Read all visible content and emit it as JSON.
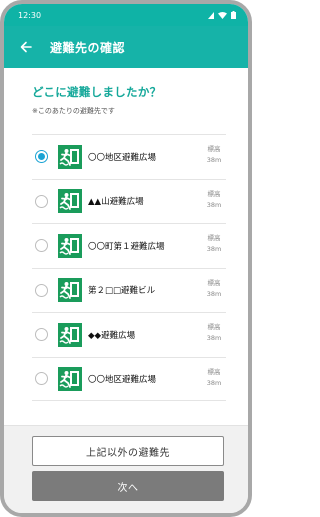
{
  "status_bar": {
    "time": "12:30"
  },
  "header": {
    "title": "避難先の確認"
  },
  "question": "どこに避難しましたか？",
  "note": "※このあたりの避難先です",
  "list": [
    {
      "name": "〇〇地区避難広場",
      "alt_label": "標高",
      "alt_value": "38m",
      "selected": true
    },
    {
      "name": "▲▲山避難広場",
      "alt_label": "標高",
      "alt_value": "38m",
      "selected": false
    },
    {
      "name": "〇〇町第１避難広場",
      "alt_label": "標高",
      "alt_value": "38m",
      "selected": false
    },
    {
      "name": "第２□□避難ビル",
      "alt_label": "標高",
      "alt_value": "38m",
      "selected": false
    },
    {
      "name": "◆◆避難広場",
      "alt_label": "標高",
      "alt_value": "38m",
      "selected": false
    },
    {
      "name": "〇〇地区避難広場",
      "alt_label": "標高",
      "alt_value": "38m",
      "selected": false
    }
  ],
  "buttons": {
    "other": "上記以外の避難先",
    "next": "次へ"
  },
  "colors": {
    "accent": "#16b3a8",
    "radio": "#1aa3d4",
    "pictogram": "#1a9c5b"
  },
  "icons": {
    "back": "arrow-left-icon",
    "evacuation": "evacuation-site-icon"
  }
}
